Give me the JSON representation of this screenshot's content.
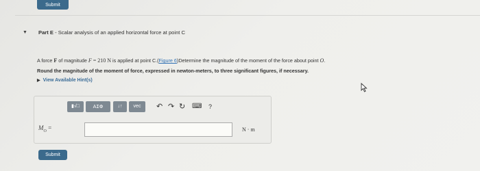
{
  "submit_label": "Submit",
  "part": {
    "title_bold": "Part E",
    "title_rest": " - Scalar analysis of an applied horizontal force at point C",
    "q1": {
      "t1": "A force ",
      "F_bold": "F",
      "t2": " of magnitude ",
      "F_italic": "F",
      "t3": " = 210 ",
      "N": "N",
      "t4": " is applied at point C.(",
      "figure_link": "Figure 6",
      "t5": ")Determine the magnitude of the moment of the force about point ",
      "O": "O",
      "t6": "."
    },
    "q2": "Round the magnitude of the moment of force, expressed in newton-meters, to three significant figures, if necessary.",
    "hints_label": "View Available Hint(s)"
  },
  "toolbar": {
    "templates": "▮√□",
    "greek": "ΑΣΦ",
    "arrows": "↓↑",
    "vec": "vec",
    "undo": "↶",
    "redo": "↷",
    "reset": "↻",
    "keyboard": "⌨",
    "help": "?"
  },
  "answer": {
    "label_main": "M",
    "label_sub": "O",
    "label_eq": " =",
    "value": "",
    "units": "N · m"
  }
}
